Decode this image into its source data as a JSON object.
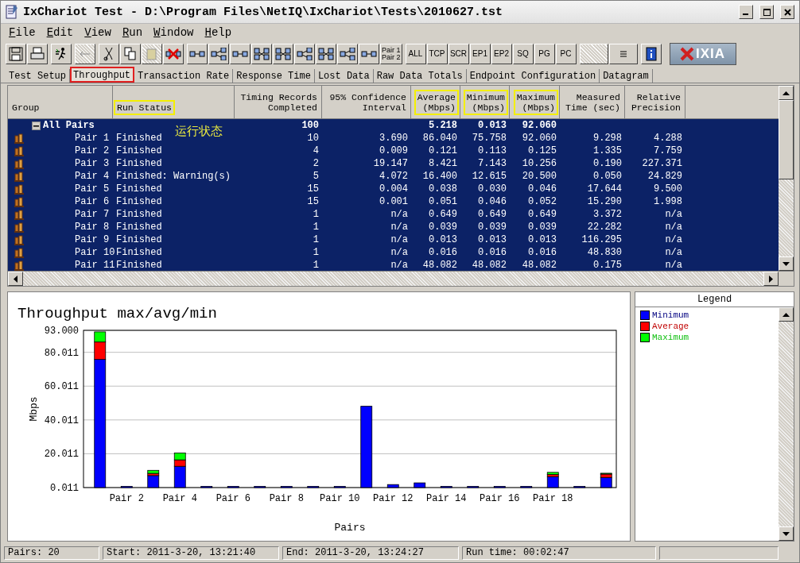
{
  "window": {
    "title": "IxChariot Test - D:\\Program Files\\NetIQ\\IxChariot\\Tests\\2010627.tst"
  },
  "menu": [
    "File",
    "Edit",
    "View",
    "Run",
    "Window",
    "Help"
  ],
  "toolbar": {
    "pair_button": [
      "Pair 1",
      "Pair 2"
    ],
    "filters": [
      "ALL",
      "TCP",
      "SCR",
      "EP1",
      "EP2",
      "SQ",
      "PG",
      "PC"
    ],
    "logo": "IXIA"
  },
  "tabs": [
    {
      "label": "Test Setup",
      "selected": false,
      "highlighted": false
    },
    {
      "label": "Throughput",
      "selected": true,
      "highlighted": true
    },
    {
      "label": "Transaction Rate",
      "selected": false,
      "highlighted": false
    },
    {
      "label": "Response Time",
      "selected": false,
      "highlighted": false
    },
    {
      "label": "Lost Data",
      "selected": false,
      "highlighted": false
    },
    {
      "label": "Raw Data Totals",
      "selected": false,
      "highlighted": false
    },
    {
      "label": "Endpoint Configuration",
      "selected": false,
      "highlighted": false
    },
    {
      "label": "Datagram",
      "selected": false,
      "highlighted": false
    }
  ],
  "table": {
    "columns": [
      {
        "label": "Group",
        "highlighted": false
      },
      {
        "label": "Run Status",
        "highlighted": true
      },
      {
        "label": "Timing Records\nCompleted",
        "highlighted": false
      },
      {
        "label": "95% Confidence\nInterval",
        "highlighted": false
      },
      {
        "label": "Average\n(Mbps)",
        "highlighted": true
      },
      {
        "label": "Minimum\n(Mbps)",
        "highlighted": true
      },
      {
        "label": "Maximum\n(Mbps)",
        "highlighted": true
      },
      {
        "label": "Measured\nTime (sec)",
        "highlighted": false
      },
      {
        "label": "Relative\nPrecision",
        "highlighted": false
      }
    ],
    "annotation": "运行状态",
    "rows": [
      {
        "kind": "summary",
        "expanded": true,
        "selected": true,
        "cells": [
          "All Pairs",
          "",
          "100",
          "",
          "5.218",
          "0.013",
          "92.060",
          "",
          ""
        ]
      },
      {
        "kind": "pair",
        "selected": true,
        "cells": [
          "Pair 1",
          "Finished",
          "10",
          "3.690",
          "86.040",
          "75.758",
          "92.060",
          "9.298",
          "4.288"
        ]
      },
      {
        "kind": "pair",
        "selected": true,
        "cells": [
          "Pair 2",
          "Finished",
          "4",
          "0.009",
          "0.121",
          "0.113",
          "0.125",
          "1.335",
          "7.759"
        ]
      },
      {
        "kind": "pair",
        "selected": true,
        "cells": [
          "Pair 3",
          "Finished",
          "2",
          "19.147",
          "8.421",
          "7.143",
          "10.256",
          "0.190",
          "227.371"
        ]
      },
      {
        "kind": "pair",
        "selected": true,
        "cells": [
          "Pair 4",
          "Finished: Warning(s)",
          "5",
          "4.072",
          "16.400",
          "12.615",
          "20.500",
          "0.050",
          "24.829"
        ]
      },
      {
        "kind": "pair",
        "selected": true,
        "cells": [
          "Pair 5",
          "Finished",
          "15",
          "0.004",
          "0.038",
          "0.030",
          "0.046",
          "17.644",
          "9.500"
        ]
      },
      {
        "kind": "pair",
        "selected": true,
        "cells": [
          "Pair 6",
          "Finished",
          "15",
          "0.001",
          "0.051",
          "0.046",
          "0.052",
          "15.290",
          "1.998"
        ]
      },
      {
        "kind": "pair",
        "selected": true,
        "cells": [
          "Pair 7",
          "Finished",
          "1",
          "n/a",
          "0.649",
          "0.649",
          "0.649",
          "3.372",
          "n/a"
        ]
      },
      {
        "kind": "pair",
        "selected": true,
        "cells": [
          "Pair 8",
          "Finished",
          "1",
          "n/a",
          "0.039",
          "0.039",
          "0.039",
          "22.282",
          "n/a"
        ]
      },
      {
        "kind": "pair",
        "selected": true,
        "cells": [
          "Pair 9",
          "Finished",
          "1",
          "n/a",
          "0.013",
          "0.013",
          "0.013",
          "116.295",
          "n/a"
        ]
      },
      {
        "kind": "pair",
        "selected": true,
        "cells": [
          "Pair 10",
          "Finished",
          "1",
          "n/a",
          "0.016",
          "0.016",
          "0.016",
          "48.830",
          "n/a"
        ]
      },
      {
        "kind": "pair",
        "selected": true,
        "cells": [
          "Pair 11",
          "Finished",
          "1",
          "n/a",
          "48.082",
          "48.082",
          "48.082",
          "0.175",
          "n/a"
        ]
      }
    ]
  },
  "chart": {
    "chart_data": {
      "type": "bar",
      "stacked": true,
      "title": "Throughput max/avg/min",
      "xlabel": "Pairs",
      "ylabel": "Mbps",
      "grid": true,
      "categories": [
        null,
        "Pair 2",
        null,
        "Pair 4",
        null,
        "Pair 6",
        null,
        "Pair 8",
        null,
        "Pair 10",
        null,
        "Pair 12",
        null,
        "Pair 14",
        null,
        "Pair 16",
        null,
        "Pair 18",
        null,
        null
      ],
      "series": [
        {
          "name": "Minimum",
          "color": "#0000ff",
          "values": [
            75.8,
            0.1,
            7.1,
            12.6,
            0.1,
            0.1,
            0.6,
            0.1,
            0.1,
            0.1,
            48.1,
            1.8,
            2.8,
            0.3,
            0.3,
            0.6,
            0.3,
            6.5,
            0.3,
            6.0
          ]
        },
        {
          "name": "Average",
          "color": "#ff0000",
          "values": [
            10.3,
            null,
            1.3,
            3.8,
            null,
            null,
            null,
            null,
            null,
            null,
            null,
            null,
            null,
            null,
            null,
            null,
            null,
            1.3,
            null,
            2.0
          ]
        },
        {
          "name": "Maximum",
          "color": "#00ff00",
          "values": [
            6.0,
            null,
            1.8,
            4.1,
            null,
            null,
            null,
            null,
            null,
            null,
            null,
            null,
            null,
            null,
            null,
            null,
            null,
            1.2,
            null,
            0.5
          ]
        }
      ],
      "ylim": [
        0.011,
        93.0
      ],
      "yticks": [
        {
          "value": 0.011,
          "label": "0.011"
        },
        {
          "value": 20.011,
          "label": "20.011"
        },
        {
          "value": 40.011,
          "label": "40.011"
        },
        {
          "value": 60.011,
          "label": "60.011"
        },
        {
          "value": 80.011,
          "label": "80.011"
        },
        {
          "value": 93.0,
          "label": "93.000"
        }
      ]
    }
  },
  "legend": {
    "title": "Legend"
  },
  "status_bar": [
    "Pairs: 20",
    "Start: 2011-3-20, 13:21:40",
    "End: 2011-3-20, 13:24:27",
    "Run time: 00:02:47"
  ]
}
